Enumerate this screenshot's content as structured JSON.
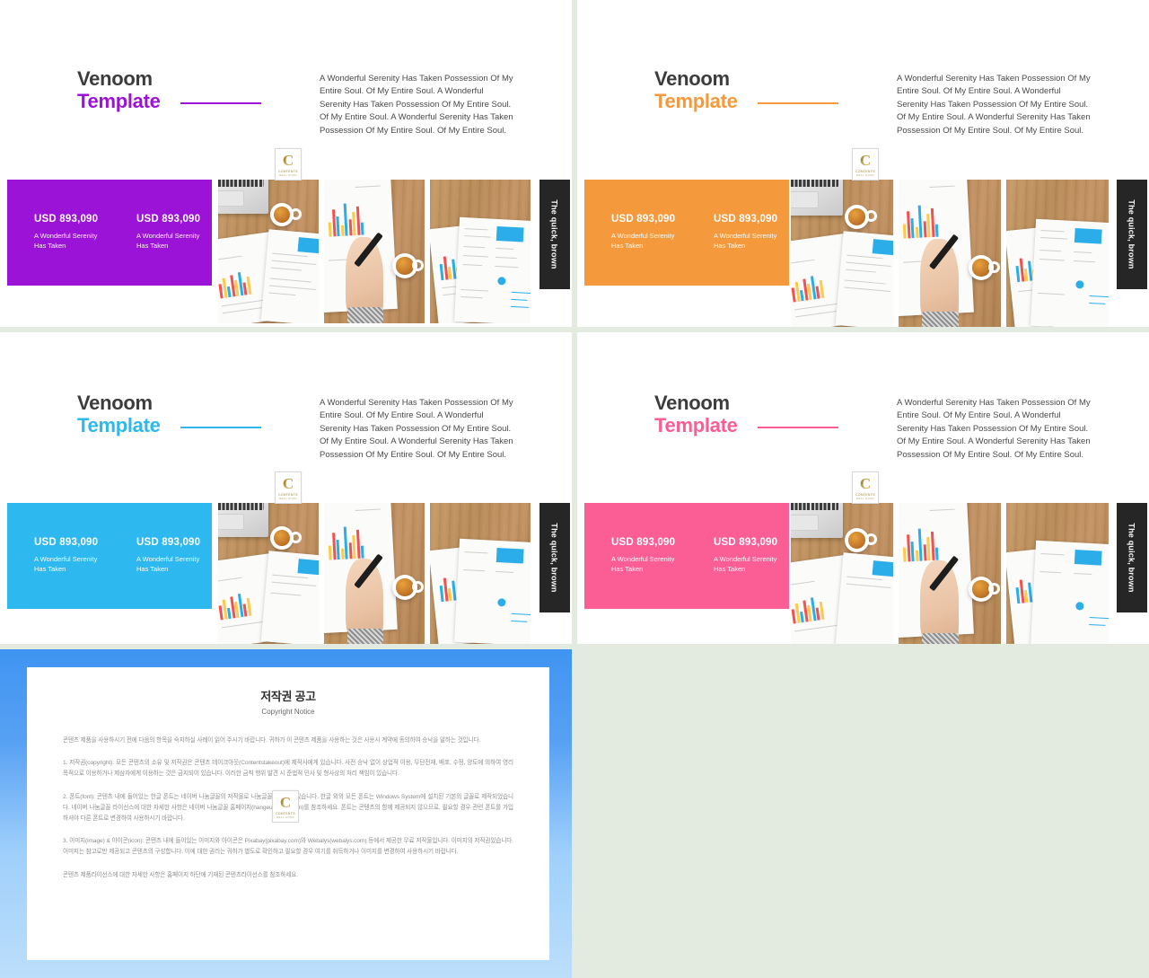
{
  "page": {
    "background_color": "#e3ebe0",
    "card_background": "#ffffff"
  },
  "brand": {
    "title_line1": "Venoom",
    "title_line2": "Template",
    "blurb": "A Wonderful Serenity Has Taken Possession Of My Entire Soul. Of My Entire Soul. A Wonderful Serenity Has Taken Possession Of My Entire Soul. Of My Entire Soul. A Wonderful Serenity Has Taken Possession Of My Entire Soul. Of My Entire Soul.",
    "title_line1_color": "#3c3c3c"
  },
  "logo": {
    "monogram": "C",
    "word": "CONTENTS",
    "subword": "REAL  GOOD"
  },
  "stats": {
    "amount": "USD 893,090",
    "description": "A Wonderful  Serenity\nHas Taken",
    "cells": [
      {
        "amount": "USD 893,090",
        "description_line1": "A Wonderful  Serenity",
        "description_line2": "Has Taken"
      },
      {
        "amount": "USD 893,090",
        "description_line1": "A Wonderful  Serenity",
        "description_line2": "Has Taken"
      }
    ]
  },
  "sidebar": {
    "vertical_label": "The quick, brown",
    "background_color": "#262626"
  },
  "slides": [
    {
      "id": "slide-purple",
      "accent_color": "#9a13d6",
      "accent_name": "purple",
      "title_line1": "Venoom",
      "title_line2": "Template",
      "rule_color": "#9a13d6"
    },
    {
      "id": "slide-orange",
      "accent_color": "#f59a3c",
      "accent_name": "orange",
      "title_line1": "Venoom",
      "title_line2": "Template",
      "rule_color": "#f59a3c"
    },
    {
      "id": "slide-cyan",
      "accent_color": "#2eb8f0",
      "accent_name": "cyan",
      "title_line1": "Venoom",
      "title_line2": "Template",
      "rule_color": "#2eb8f0"
    },
    {
      "id": "slide-pink",
      "accent_color": "#fa5e94",
      "accent_name": "pink",
      "title_line1": "Venoom",
      "title_line2": "Template",
      "rule_color": "#fa5e94"
    }
  ],
  "copyright_slide": {
    "frame_top_color": "#3f94f2",
    "frame_bottom_color": "#bcdefb",
    "title_ko": "저작권 공고",
    "title_en": "Copyright Notice",
    "intro": "콘텐츠 제품을 사용하시기 전에 다음의 항목을 숙지하실 사례이 읽어 주시기 바랍니다. 귀하가 이 콘텐츠 제품을 사용하는 것은 사용시 계약에 동의하여 승낙을 말하는 것입니다.",
    "paragraphs": [
      "1. 저작권(copyright): 모든 콘텐츠의 소유 및 저작권은 콘텐츠 테이크아웃(Contentstakeout)에 제작사에게 있습니다. 사전 승낙 없이 상업적 이용, 무단전재, 배포, 수정, 양도에 의하여 영리 목적으로 이용하거나 제삼자에게 이용하는 것은 금지되어 있습니다. 이러한 금칙 행위 발견 시 준법적 민사 및 형사상의 처리 책임이 있습니다.",
      "2. 폰트(font): 콘텐츠 내에 들어있는 한글 폰트는 네이버 나눔글꼴의 저작물로 나눔글꼴에 저작권있습니다. 한글 외의 모든 폰트는 Windows System에 설치된 기본의 글꼴로 제작되었습니다. 네이버 나눔글꼴 라이선스에 대한 자세한 사항은 네이버 나눔글꼴 홈페이지(hangeul.naver.com)를 참조하세요. 폰트는 콘텐츠의 함께 제공되지 않으므로, 필요할 경우 관련 폰트를 가입하셔야 다른 폰트로 변경하여 사용하시기 바랍니다.",
      "3. 이미지(image) & 아이콘(icon): 콘텐츠 내에 들어있는 이미지와 아이콘은 Pixabay(pixabay.com)와 Webalys(webalys.com) 등에서 제공한 무료 저작물입니다. 이미지의 저작권있습니다. 이미지는 참고로만 제공되고 콘텐츠의 구성합니다. 이에 대한 권리는 귀하가 별도로 확인하고 필요할 경우 여기를 취득하거나 이미지를 변경하여 사용하시기 바랍니다.",
      "콘텐츠 제품라이선스에 대한 자세한 사항은 홈페이지 하단에 기재된 콘텐츠라이선스를 참조하세요."
    ]
  }
}
